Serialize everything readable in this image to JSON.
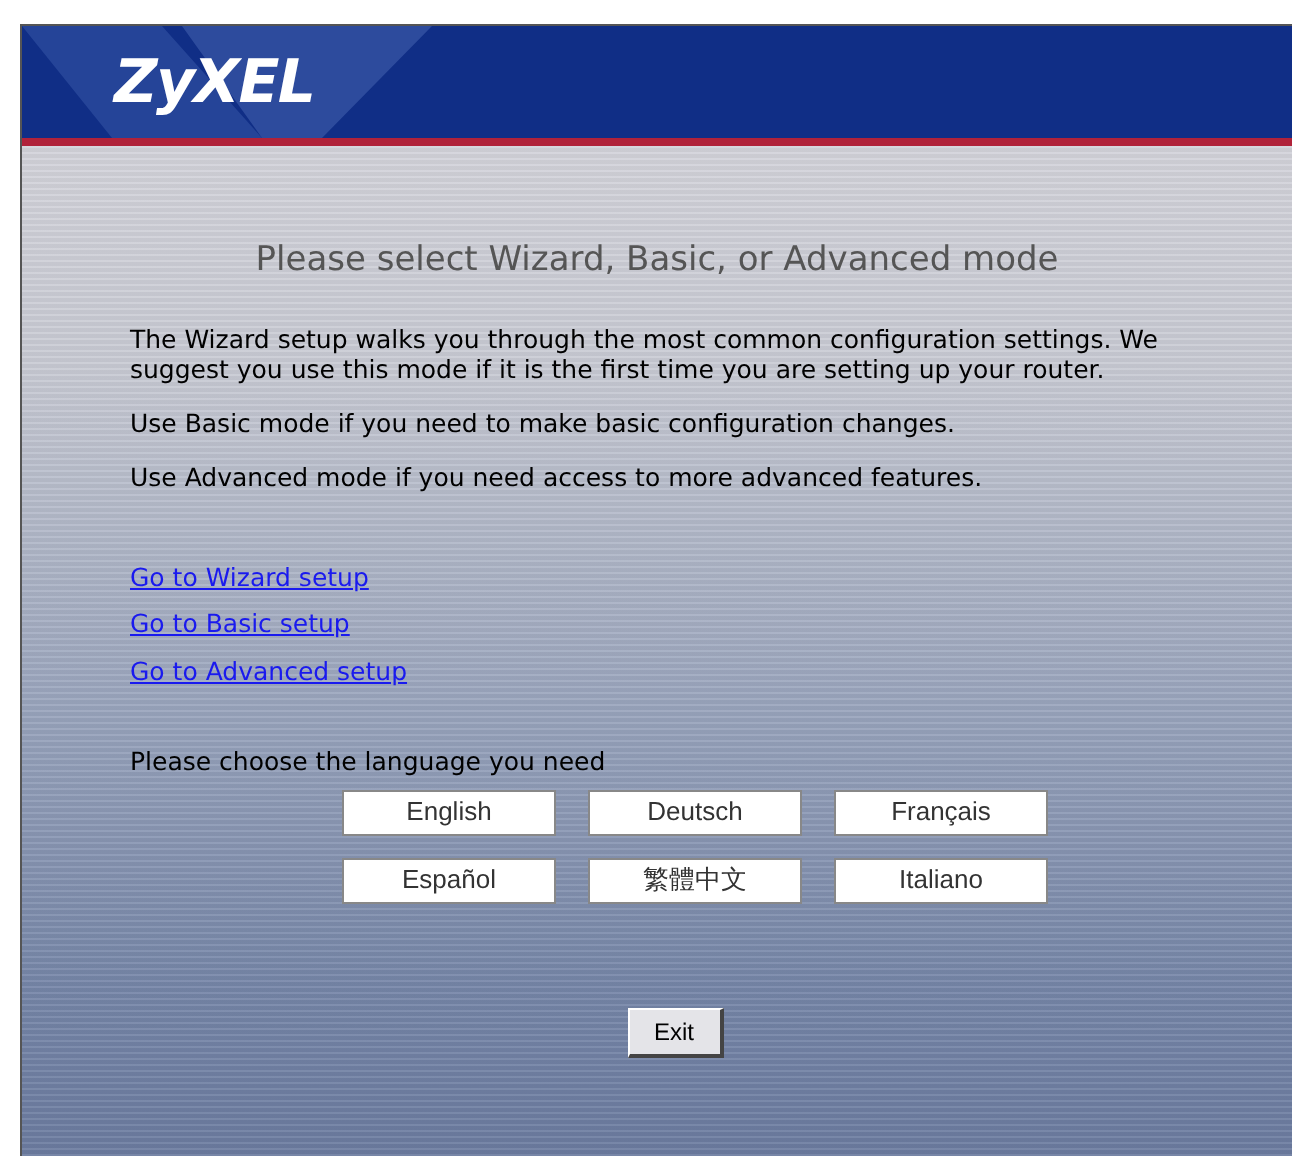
{
  "logo": "ZyXEL",
  "title": "Please select Wizard, Basic, or Advanced mode",
  "paragraphs": [
    "The Wizard setup walks you through the most common configuration settings. We suggest you use this mode if it is the first time you are setting up your router.",
    "Use Basic mode if you need to make basic configuration changes.",
    "Use Advanced mode if you need access to more advanced features."
  ],
  "links": [
    "Go to Wizard setup",
    "Go to Basic setup",
    "Go to Advanced setup"
  ],
  "language_prompt": "Please choose the language you need",
  "languages": [
    "English",
    "Deutsch",
    "Français",
    "Español",
    "繁體中文",
    "Italiano"
  ],
  "exit_button": "Exit"
}
